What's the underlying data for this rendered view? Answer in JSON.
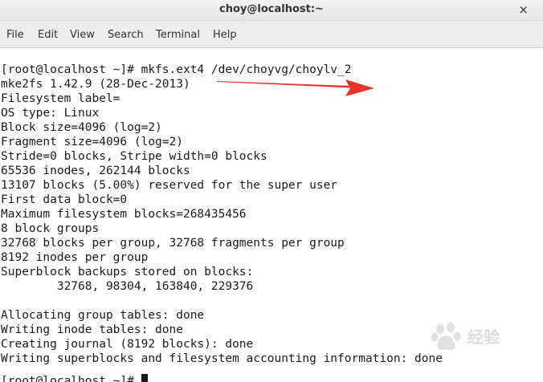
{
  "window": {
    "title": "choy@localhost:~",
    "close_symbol": "×"
  },
  "menu": {
    "items": [
      "File",
      "Edit",
      "View",
      "Search",
      "Terminal",
      "Help"
    ]
  },
  "terminal": {
    "lines": [
      "[root@localhost ~]# mkfs.ext4 /dev/choyvg/choylv_2",
      "mke2fs 1.42.9 (28-Dec-2013)",
      "Filesystem label=",
      "OS type: Linux",
      "Block size=4096 (log=2)",
      "Fragment size=4096 (log=2)",
      "Stride=0 blocks, Stripe width=0 blocks",
      "65536 inodes, 262144 blocks",
      "13107 blocks (5.00%) reserved for the super user",
      "First data block=0",
      "Maximum filesystem blocks=268435456",
      "8 block groups",
      "32768 blocks per group, 32768 fragments per group",
      "8192 inodes per group",
      "Superblock backups stored on blocks:",
      "        32768, 98304, 163840, 229376",
      "",
      "Allocating group tables: done",
      "Writing inode tables: done",
      "Creating journal (8192 blocks): done",
      "Writing superblocks and filesystem accounting information: done",
      "",
      "[root@localhost ~]# "
    ]
  },
  "annotation": {
    "arrow_color": "#e8322a",
    "icon": "red-arrow-icon"
  },
  "watermark": {
    "text": "经验",
    "icon": "baidu-paw-icon"
  }
}
